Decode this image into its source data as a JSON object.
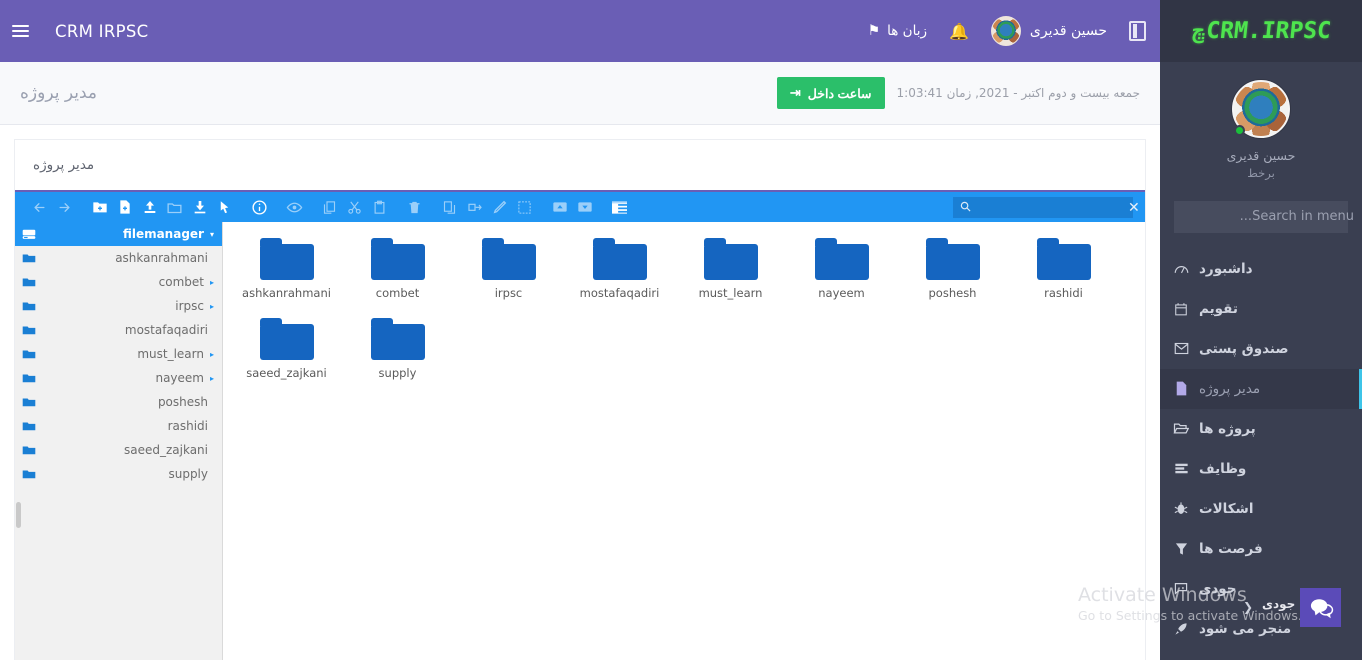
{
  "colors": {
    "topbar": "#6a5eb5",
    "sidebar": "#3a3f51",
    "sidebar_brand_bg": "#313545",
    "brand_green": "#4ee44e",
    "accent_blue": "#2196f3",
    "folder_blue": "#1565c0",
    "clock_green": "#2bbf6a",
    "active_border": "#3ec4e8"
  },
  "sidebar": {
    "brand": {
      "mark": "ڇ",
      "text": "CRM.IRPSC"
    },
    "profile": {
      "name": "حسین قدیری",
      "status": "برخط"
    },
    "search": {
      "placeholder": "Search in menu...",
      "value": "",
      "icon": "search-icon"
    },
    "items": [
      {
        "label": "داشبورد",
        "icon": "dashboard-icon",
        "glyph": "◍",
        "active": false
      },
      {
        "label": "تقویم",
        "icon": "calendar-icon",
        "glyph": "▦",
        "active": false
      },
      {
        "label": "صندوق پستی",
        "icon": "mail-icon",
        "glyph": "✉",
        "active": false
      },
      {
        "label": "مدیر پروژه",
        "icon": "file-icon",
        "glyph": "▯",
        "active": true
      },
      {
        "label": "پروژه ها",
        "icon": "folder-open-icon",
        "glyph": "▱",
        "active": false
      },
      {
        "label": "وظایف",
        "icon": "tasks-icon",
        "glyph": "▤",
        "active": false
      },
      {
        "label": "اشکالات",
        "icon": "bug-icon",
        "glyph": "✳",
        "active": false
      },
      {
        "label": "فرصت ها",
        "icon": "funnel-icon",
        "glyph": "▼",
        "active": false
      },
      {
        "label": "جودی",
        "icon": "chat-icon",
        "glyph": "✦",
        "active": false
      },
      {
        "label": "منجر می شود",
        "icon": "rocket-icon",
        "glyph": "➤",
        "active": false
      }
    ]
  },
  "topbar": {
    "toggle_icon": "sidebar-toggle-icon",
    "user_name": "حسین قدیری",
    "bell_icon": "bell-icon",
    "languages_label": "زبان ها",
    "flag_icon": "flag-icon",
    "app_title": "CRM IRPSC",
    "burger_icon": "hamburger-icon"
  },
  "subbar": {
    "page_title": "مدیر پروژه",
    "clock_in_label": "ساعت داخل",
    "clock_in_icon": "sign-in-icon",
    "date_text": "جمعه بیست و دوم اکتبر - 2021, زمان  1:03:41"
  },
  "panel": {
    "head_title": "مدیر پروژه"
  },
  "filemanager": {
    "toolbar": [
      {
        "name": "back-icon",
        "glyph": "←",
        "dim": true
      },
      {
        "name": "forward-icon",
        "glyph": "→",
        "dim": true
      },
      {
        "name": "new-folder-icon",
        "glyph": "▣"
      },
      {
        "name": "new-file-icon",
        "glyph": "▤"
      },
      {
        "name": "upload-icon",
        "glyph": "⬆"
      },
      {
        "name": "open-folder-icon",
        "glyph": "▭",
        "dim": true
      },
      {
        "name": "download-icon",
        "glyph": "⬇"
      },
      {
        "name": "select-cursor-icon",
        "glyph": "➤"
      },
      {
        "name": "info-icon",
        "glyph": "ⓘ"
      },
      {
        "name": "preview-icon",
        "glyph": "◉",
        "dim": true
      },
      {
        "name": "copy-icon",
        "glyph": "⧉",
        "dim": true
      },
      {
        "name": "cut-icon",
        "glyph": "✂",
        "dim": true
      },
      {
        "name": "paste-icon",
        "glyph": "▥",
        "dim": true
      },
      {
        "name": "delete-icon",
        "glyph": "🗑",
        "dim": true
      },
      {
        "name": "duplicate-icon",
        "glyph": "❏",
        "dim": true
      },
      {
        "name": "rename-icon",
        "glyph": "⇄",
        "dim": true
      },
      {
        "name": "edit-icon",
        "glyph": "✎",
        "dim": true
      },
      {
        "name": "resize-icon",
        "glyph": "⤢",
        "dim": true
      },
      {
        "name": "collapse-icon",
        "glyph": "▲",
        "dim": true
      },
      {
        "name": "expand-icon",
        "glyph": "▼",
        "dim": true
      },
      {
        "name": "list-view-icon",
        "glyph": "▦"
      }
    ],
    "search": {
      "placeholder": "",
      "value": "",
      "icon": "search-icon",
      "clear_icon": "close-icon"
    },
    "tree": [
      {
        "label": "filemanager",
        "icon": "drive-icon",
        "caret": "▾",
        "root": true
      },
      {
        "label": "ashkanrahmani",
        "icon": "folder-icon",
        "caret": ""
      },
      {
        "label": "combet",
        "icon": "folder-icon",
        "caret": "▸"
      },
      {
        "label": "irpsc",
        "icon": "folder-icon",
        "caret": "▸"
      },
      {
        "label": "mostafaqadiri",
        "icon": "folder-icon",
        "caret": ""
      },
      {
        "label": "must_learn",
        "icon": "folder-icon",
        "caret": "▸"
      },
      {
        "label": "nayeem",
        "icon": "folder-icon",
        "caret": "▸"
      },
      {
        "label": "poshesh",
        "icon": "folder-icon",
        "caret": ""
      },
      {
        "label": "rashidi",
        "icon": "folder-icon",
        "caret": ""
      },
      {
        "label": "saeed_zajkani",
        "icon": "folder-icon",
        "caret": ""
      },
      {
        "label": "supply",
        "icon": "folder-icon",
        "caret": ""
      }
    ],
    "folders": [
      {
        "label": "ashkanrahmani",
        "icon": "folder-icon"
      },
      {
        "label": "combet",
        "icon": "folder-icon"
      },
      {
        "label": "irpsc",
        "icon": "folder-icon"
      },
      {
        "label": "mostafaqadiri",
        "icon": "folder-icon"
      },
      {
        "label": "must_learn",
        "icon": "folder-icon"
      },
      {
        "label": "nayeem",
        "icon": "folder-icon"
      },
      {
        "label": "poshesh",
        "icon": "folder-icon"
      },
      {
        "label": "rashidi",
        "icon": "folder-icon"
      },
      {
        "label": "saeed_zajkani",
        "icon": "folder-icon"
      },
      {
        "label": "supply",
        "icon": "folder-icon"
      }
    ]
  },
  "overlays": {
    "watermark_line1": "Activate Windows",
    "watermark_line2": "Go to Settings to activate Windows.",
    "chat_label": "جودی",
    "chat_icon": "chat-bubble-icon"
  }
}
